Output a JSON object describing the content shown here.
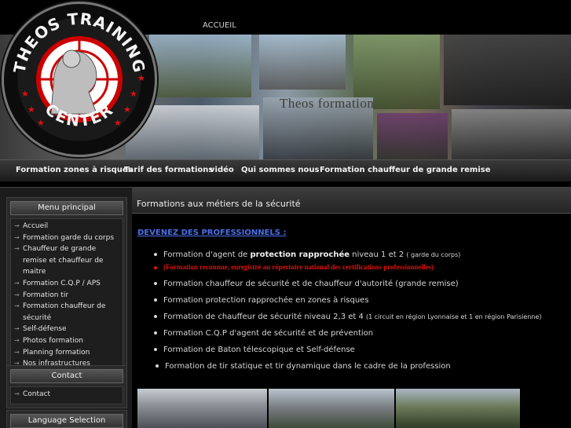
{
  "top_link": "ACCUEIL",
  "banner": {
    "title": "Theos formation",
    "logo_top_text": "THEOS TRAINING",
    "logo_bottom_text": "CENTER"
  },
  "nav": [
    "Formation zones à risques",
    "Tarif des formations",
    "vidéo",
    "Qui sommes nous",
    "Formation chauffeur de grande remise"
  ],
  "sidebar": {
    "menu_title": "Menu principal",
    "menu_items": [
      "Accueil",
      "Formation garde du corps",
      "Chauffeur de grande remise et chauffeur de maitre",
      "Formation C.Q.P / APS",
      "Formation tir",
      "Formation chauffeur de sécurité",
      "Self-défense",
      "Photos formation",
      "Planning formation",
      "Nos infrastructures"
    ],
    "contact_title": "Contact",
    "contact_items": [
      "Contact"
    ],
    "language_title": "Language Selection"
  },
  "content": {
    "heading": "Formations aux métiers de la sécurité",
    "intro_link": "DEVENEZ DES PROFESSIONNELS :",
    "bullets": {
      "b1_pre": "Formation d'agent de ",
      "b1_bold": "protection rapprochée",
      "b1_post": " niveau 1 et 2 ",
      "b1_small": "( garde du corps)",
      "b2": "(Formation reconnue, enregistré au répertoire national des certifications professionnelles)",
      "b3": "Formation chauffeur de sécurité et de chauffeur d'autorité (grande remise)",
      "b4": "Formation protection rapprochée en zones à risques",
      "b5_pre": "Formation de chauffeur de sécurité niveau 2,3 et 4 ",
      "b5_small": "(1 circuit en région Lyonnaise et 1 en région Parisienne)",
      "b6": "Formation C.Q.P d'agent de sécurité et de prévention",
      "b7": "Formation de Baton télescopique et Self-défense",
      "b8": "Formation de tir statique et tir dynamique dans le cadre de la profession"
    }
  },
  "colors": {
    "link_blue": "#4a6fe8",
    "highlight_red": "#e01010",
    "background": "#000000"
  }
}
